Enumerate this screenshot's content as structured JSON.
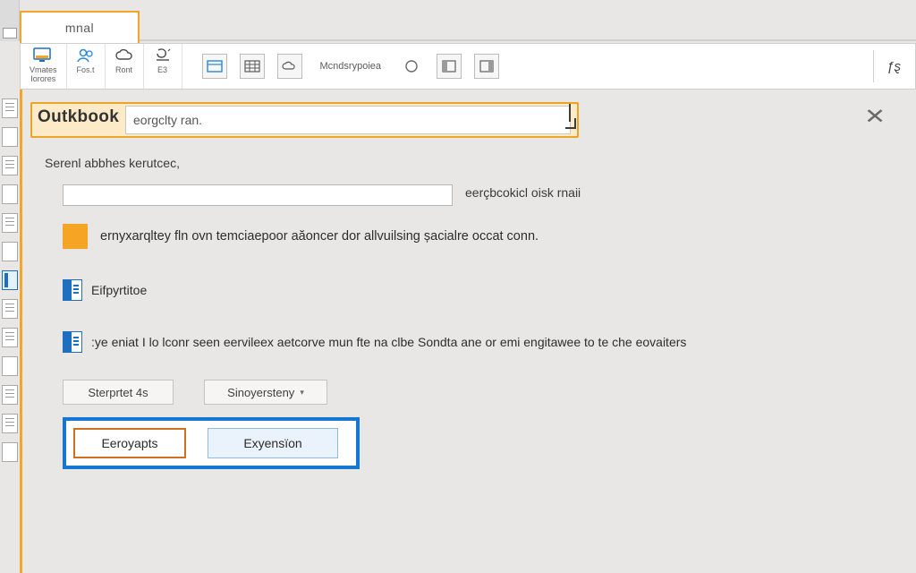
{
  "title_tab": "mnal",
  "ribbon": {
    "groups": [
      {
        "label_top": "Vmates",
        "label_bottom": "Iorores"
      },
      {
        "label_top": "",
        "label_bottom": "Fos.t"
      },
      {
        "label_top": "",
        "label_bottom": "Ront"
      },
      {
        "label_top": "",
        "label_bottom": "E3"
      }
    ],
    "more_text": "Mcndsrypoiea",
    "right_glyph": "ƒȿ"
  },
  "dialog": {
    "title": "Outkbook",
    "search_text": "eorgclty ran.",
    "intro": "Serenl abbhes kerutcec,",
    "field1_placeholder": "",
    "field1_label": "eerçbcokicl oisk rnaii",
    "row2_text": "ernyxarqltey fln ovn temciaepoor aăoncer dor allvuilsing șacialre occat conn.",
    "opt1": "Eifpyrtitoe",
    "opt2": ":ye eniat I lo lconr seen eervileex aetcorve mun fte na clbe Sondta ane or emi engitawee to te che eovaiters",
    "grey_btn1": "Sterprtet 4s",
    "grey_btn2": "Sinoyersteny",
    "primary1": "Eeroyapts",
    "primary2": "Exyensïon"
  },
  "icons": {
    "monitor": "monitor",
    "people": "people",
    "cloud": "cloud",
    "stamp": "stamp",
    "window": "window",
    "grid": "grid",
    "cloud2": "cloud2",
    "circle": "circle",
    "panel1": "panel1",
    "panel2": "panel2"
  }
}
